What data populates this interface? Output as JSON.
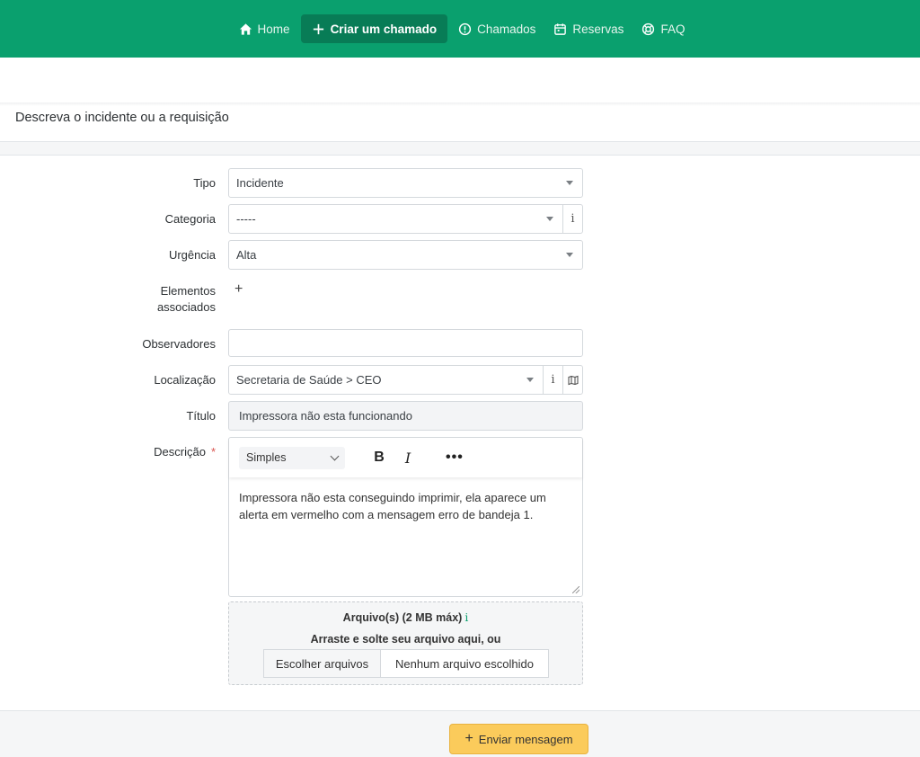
{
  "nav": {
    "items": [
      {
        "label": "Home",
        "icon": "home-icon"
      },
      {
        "label": "Criar um chamado",
        "icon": "plus-icon",
        "active": true
      },
      {
        "label": "Chamados",
        "icon": "alert-circle-icon"
      },
      {
        "label": "Reservas",
        "icon": "calendar-icon"
      },
      {
        "label": "FAQ",
        "icon": "lifebuoy-icon"
      }
    ],
    "background": "#0aa06e",
    "active_background": "#087c56"
  },
  "form": {
    "header": "Descreva o incidente ou a requisição",
    "tipo": {
      "label": "Tipo",
      "value": "Incidente"
    },
    "categoria": {
      "label": "Categoria",
      "value": "-----",
      "info": "i"
    },
    "urgencia": {
      "label": "Urgência",
      "value": "Alta"
    },
    "elementos": {
      "label_line1": "Elementos",
      "label_line2": "associados",
      "add": "+"
    },
    "observadores": {
      "label": "Observadores",
      "value": ""
    },
    "localizacao": {
      "label": "Localização",
      "value": "Secretaria de Saúde > CEO",
      "info": "i"
    },
    "titulo": {
      "label": "Título",
      "value": "Impressora não esta funcionando"
    },
    "descricao": {
      "label": "Descrição",
      "required": "*",
      "format": "Simples",
      "bold": "B",
      "italic": "I",
      "more": "•••",
      "text": "Impressora não esta conseguindo imprimir, ela aparece um alerta em vermelho com a mensagem erro de bandeja 1."
    },
    "files": {
      "title": "Arquivo(s) (2 MB máx)",
      "info": "i",
      "hint": "Arraste e solte seu arquivo aqui, ou",
      "choose": "Escolher arquivos",
      "status": "Nenhum arquivo escolhido"
    },
    "submit": {
      "plus": "+",
      "label": "Enviar mensagem",
      "color": "#fbcb5b"
    }
  }
}
